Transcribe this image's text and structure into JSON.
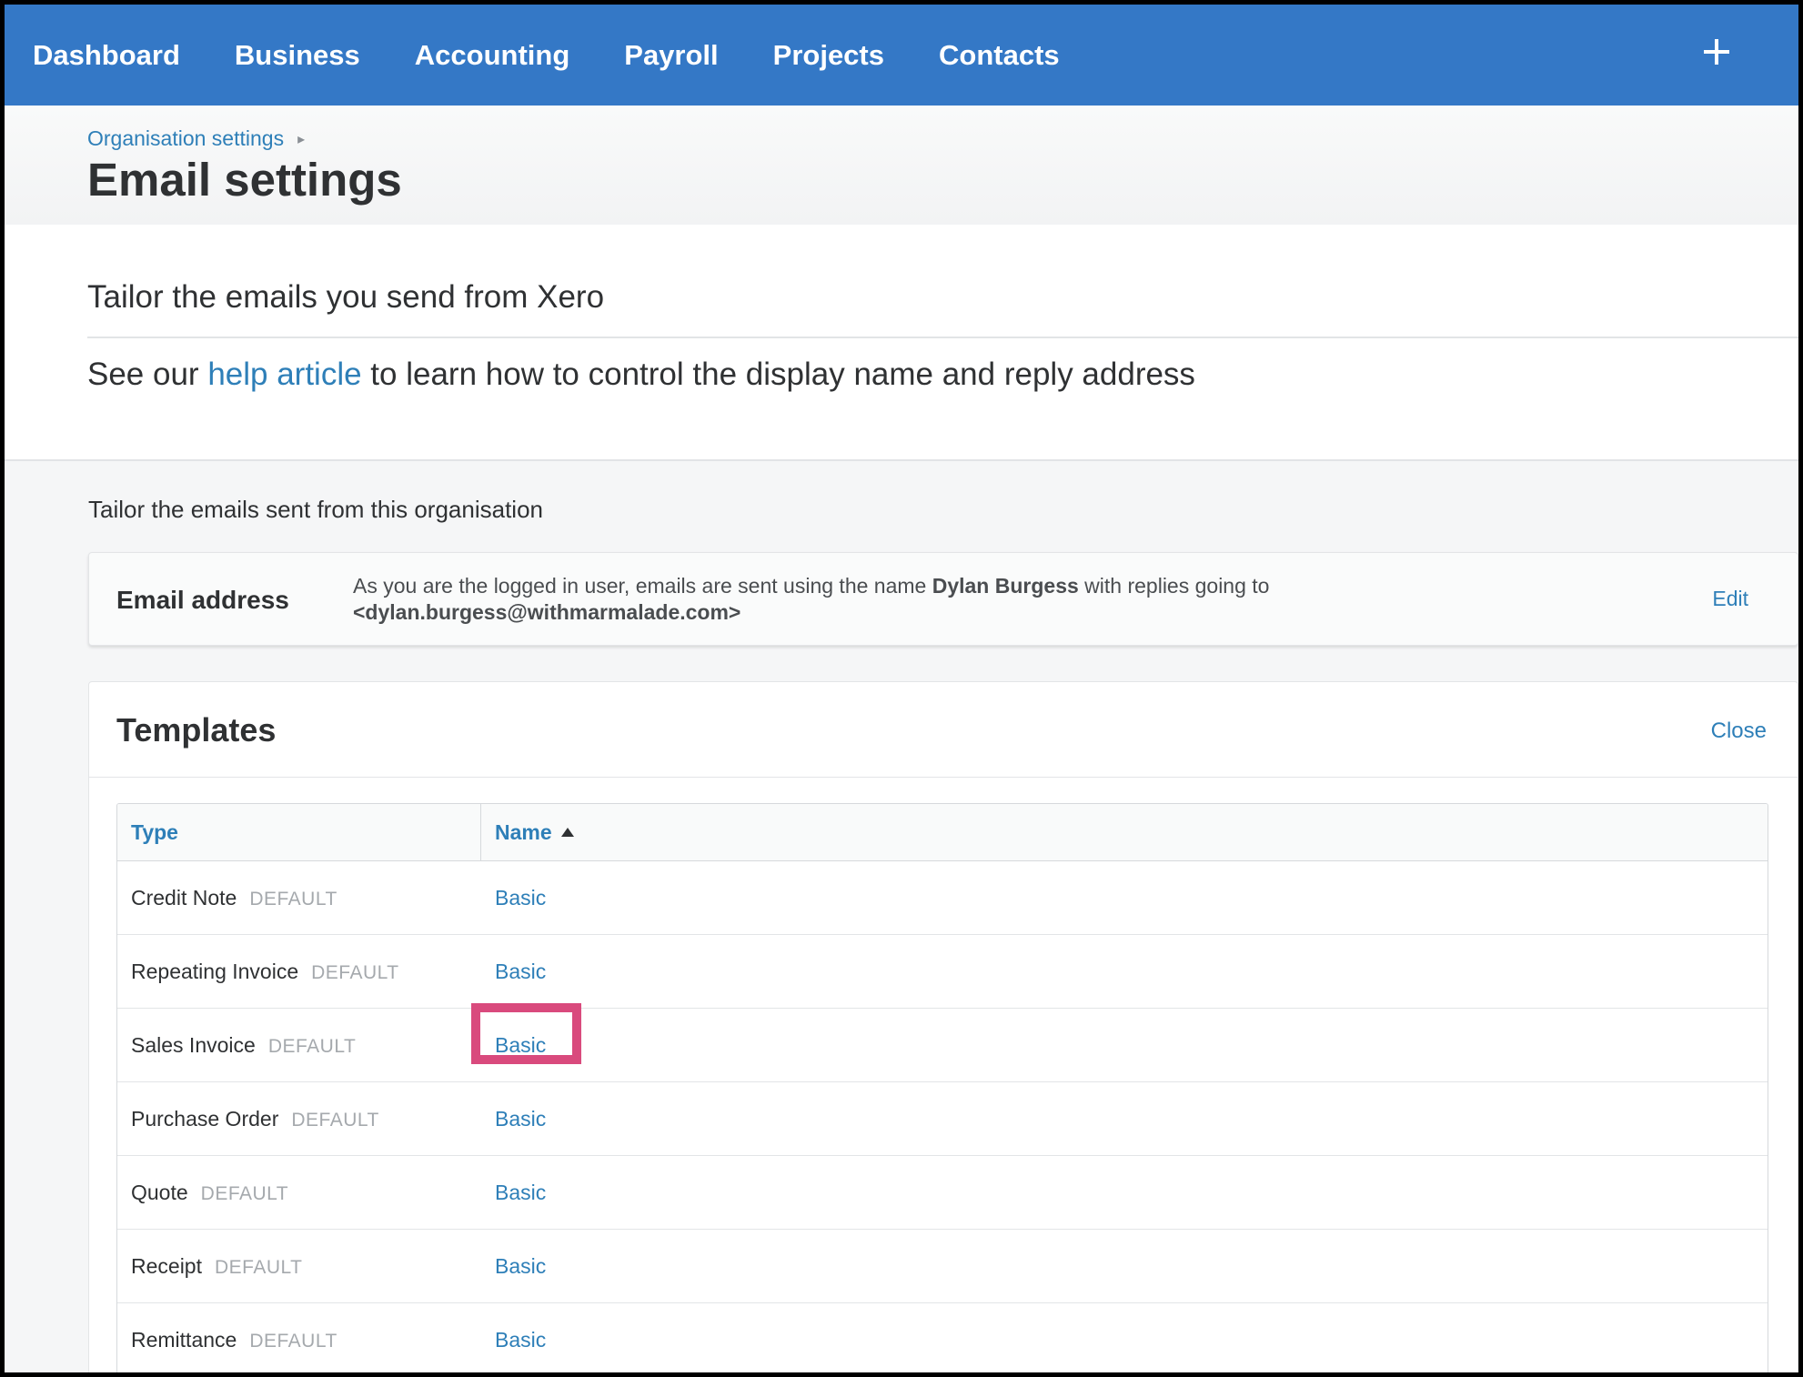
{
  "nav": {
    "items": [
      "Dashboard",
      "Business",
      "Accounting",
      "Payroll",
      "Projects",
      "Contacts"
    ],
    "plus_icon": "plus-icon"
  },
  "breadcrumb": {
    "parent": "Organisation settings"
  },
  "page": {
    "title": "Email settings"
  },
  "intro": {
    "heading": "Tailor the emails you send from Xero",
    "help_prefix": "See our ",
    "help_link": "help article",
    "help_suffix": " to learn how to control the display name and reply address"
  },
  "section_caption": "Tailor the emails sent from this organisation",
  "email_card": {
    "label": "Email address",
    "desc_prefix": "As you are the logged in user, emails are sent using the name ",
    "user_name": "Dylan Burgess",
    "desc_mid": " with replies going to",
    "reply_address": "<dylan.burgess@withmarmalade.com>",
    "edit_label": "Edit"
  },
  "templates": {
    "title": "Templates",
    "close_label": "Close",
    "columns": {
      "type": "Type",
      "name": "Name"
    },
    "rows": [
      {
        "type": "Credit Note",
        "badge": "DEFAULT",
        "name": "Basic"
      },
      {
        "type": "Repeating Invoice",
        "badge": "DEFAULT",
        "name": "Basic"
      },
      {
        "type": "Sales Invoice",
        "badge": "DEFAULT",
        "name": "Basic"
      },
      {
        "type": "Purchase Order",
        "badge": "DEFAULT",
        "name": "Basic"
      },
      {
        "type": "Quote",
        "badge": "DEFAULT",
        "name": "Basic"
      },
      {
        "type": "Receipt",
        "badge": "DEFAULT",
        "name": "Basic"
      },
      {
        "type": "Remittance",
        "badge": "DEFAULT",
        "name": "Basic"
      }
    ]
  },
  "colors": {
    "nav_bg": "#3478c6",
    "link": "#2e7fb8",
    "highlight": "#d94a7d"
  }
}
